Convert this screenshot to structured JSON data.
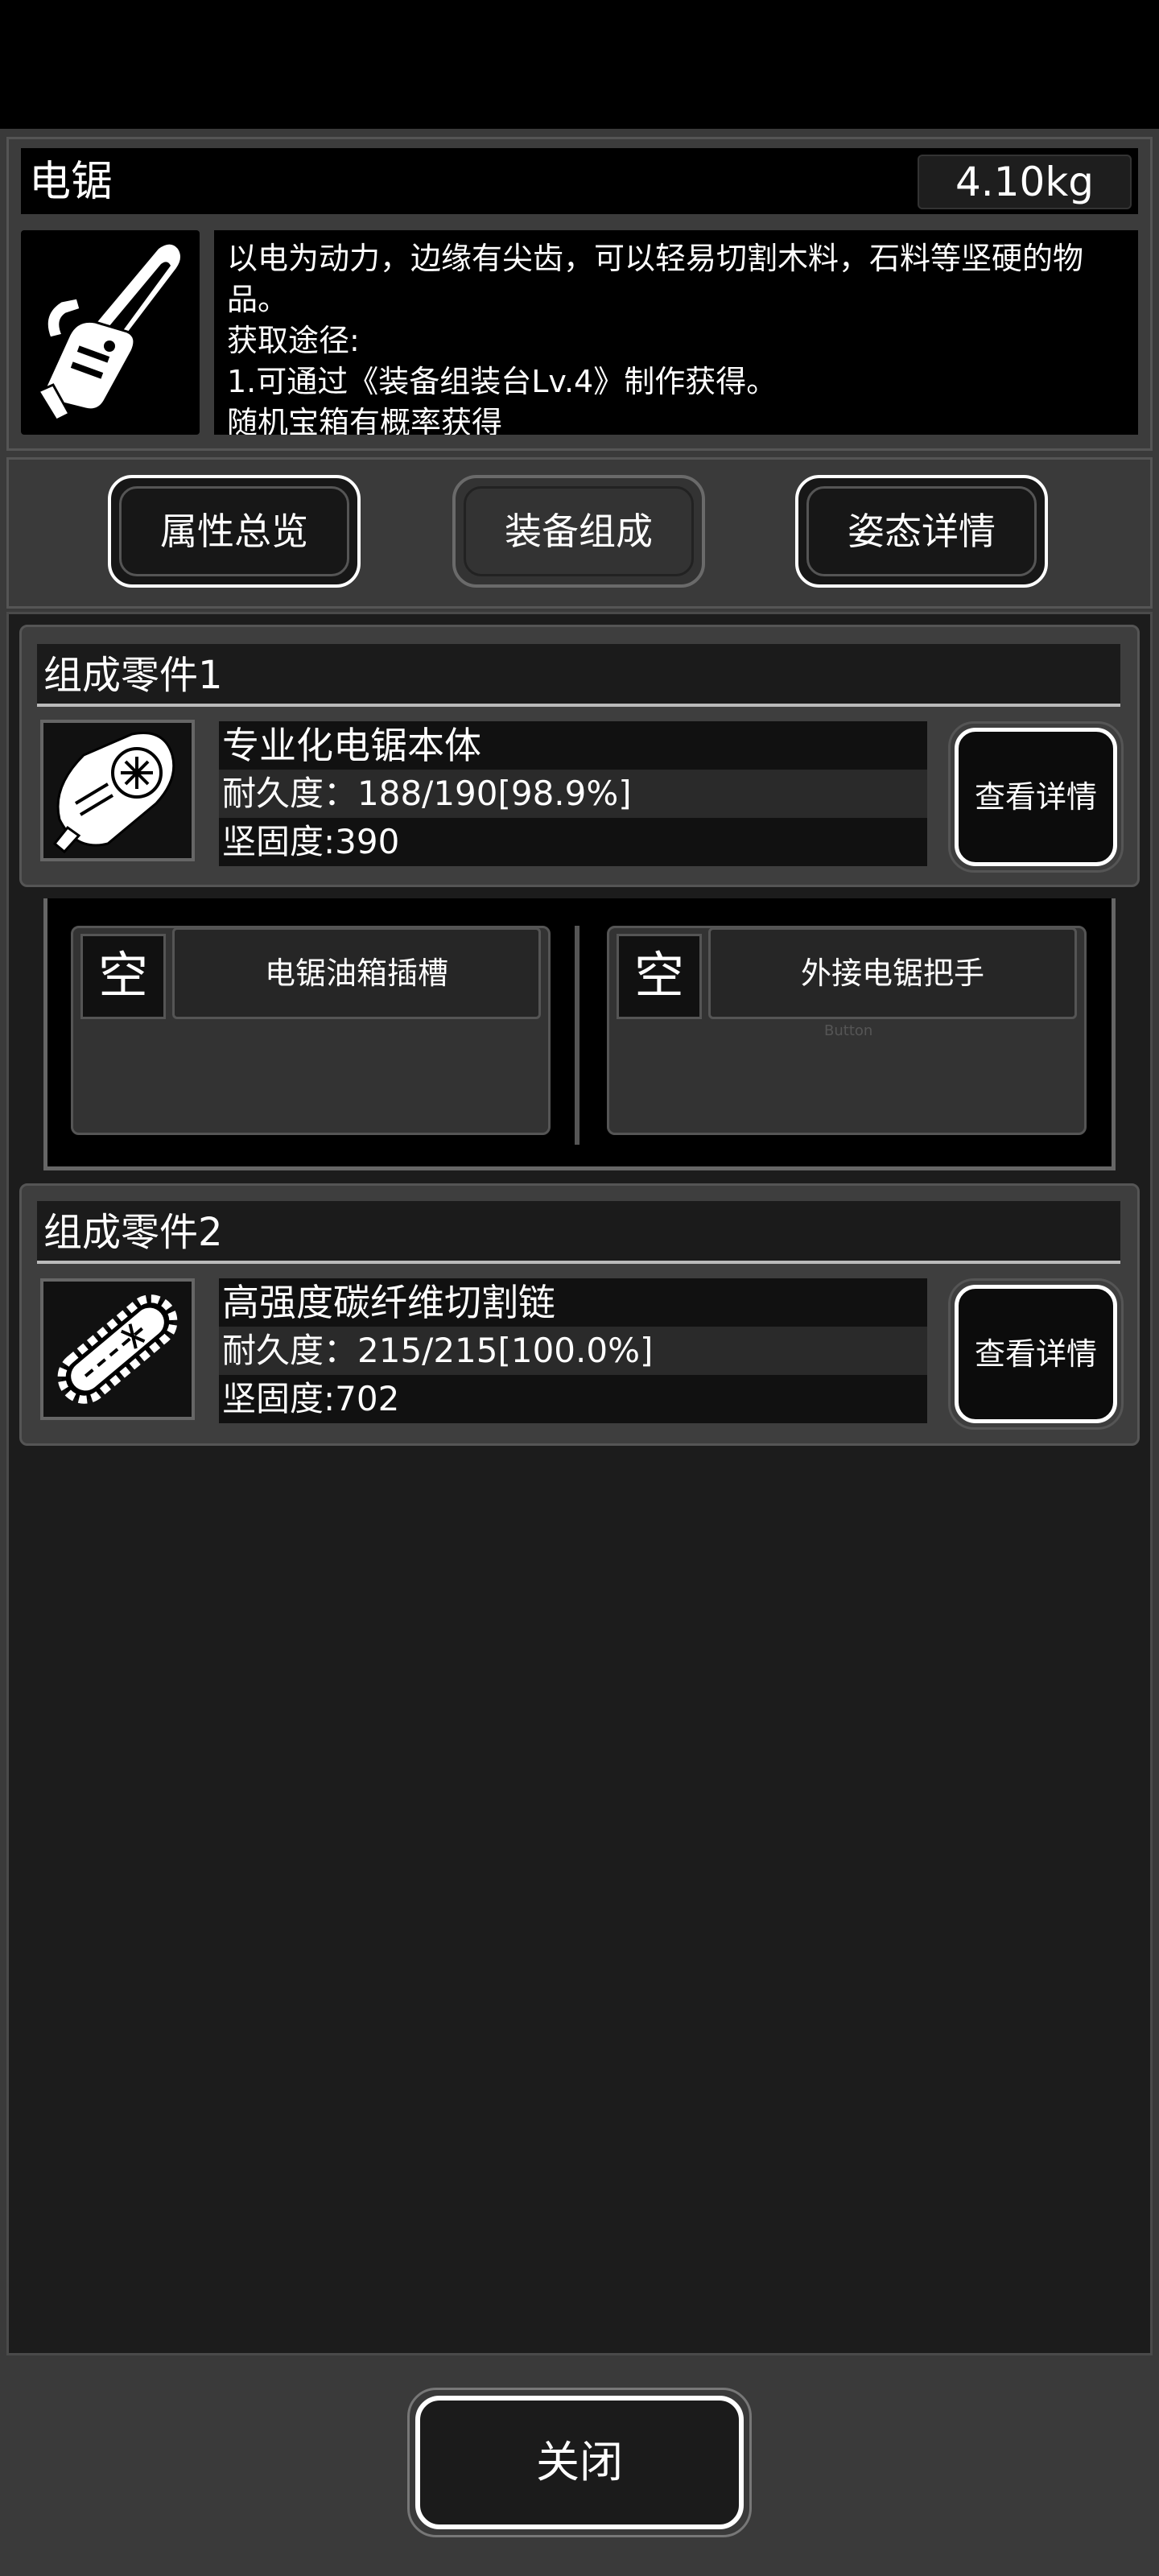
{
  "item": {
    "name": "电锯",
    "weight": "4.10kg",
    "description": [
      "以电为动力，边缘有尖齿，可以轻易切割木料，石料等坚硬的物品。",
      "获取途径:",
      "1.可通过《装备组装台Lv.4》制作获得。",
      "随机宝箱有概率获得"
    ]
  },
  "tabs": [
    {
      "label": "属性总览"
    },
    {
      "label": "装备组成"
    },
    {
      "label": "姿态详情"
    }
  ],
  "parts": [
    {
      "title": "组成零件1",
      "name": "专业化电锯本体",
      "durability": "耐久度：188/190[98.9%]",
      "hardness": "坚固度:390",
      "detail_label": "查看详情"
    },
    {
      "title": "组成零件2",
      "name": "高强度碳纤维切割链",
      "durability": "耐久度：215/215[100.0%]",
      "hardness": "坚固度:702",
      "detail_label": "查看详情"
    }
  ],
  "slots": [
    {
      "empty_label": "空",
      "label": "电锯油箱插槽"
    },
    {
      "empty_label": "空",
      "label": "外接电锯把手"
    }
  ],
  "ghost_text": "Button",
  "close_label": "关闭"
}
